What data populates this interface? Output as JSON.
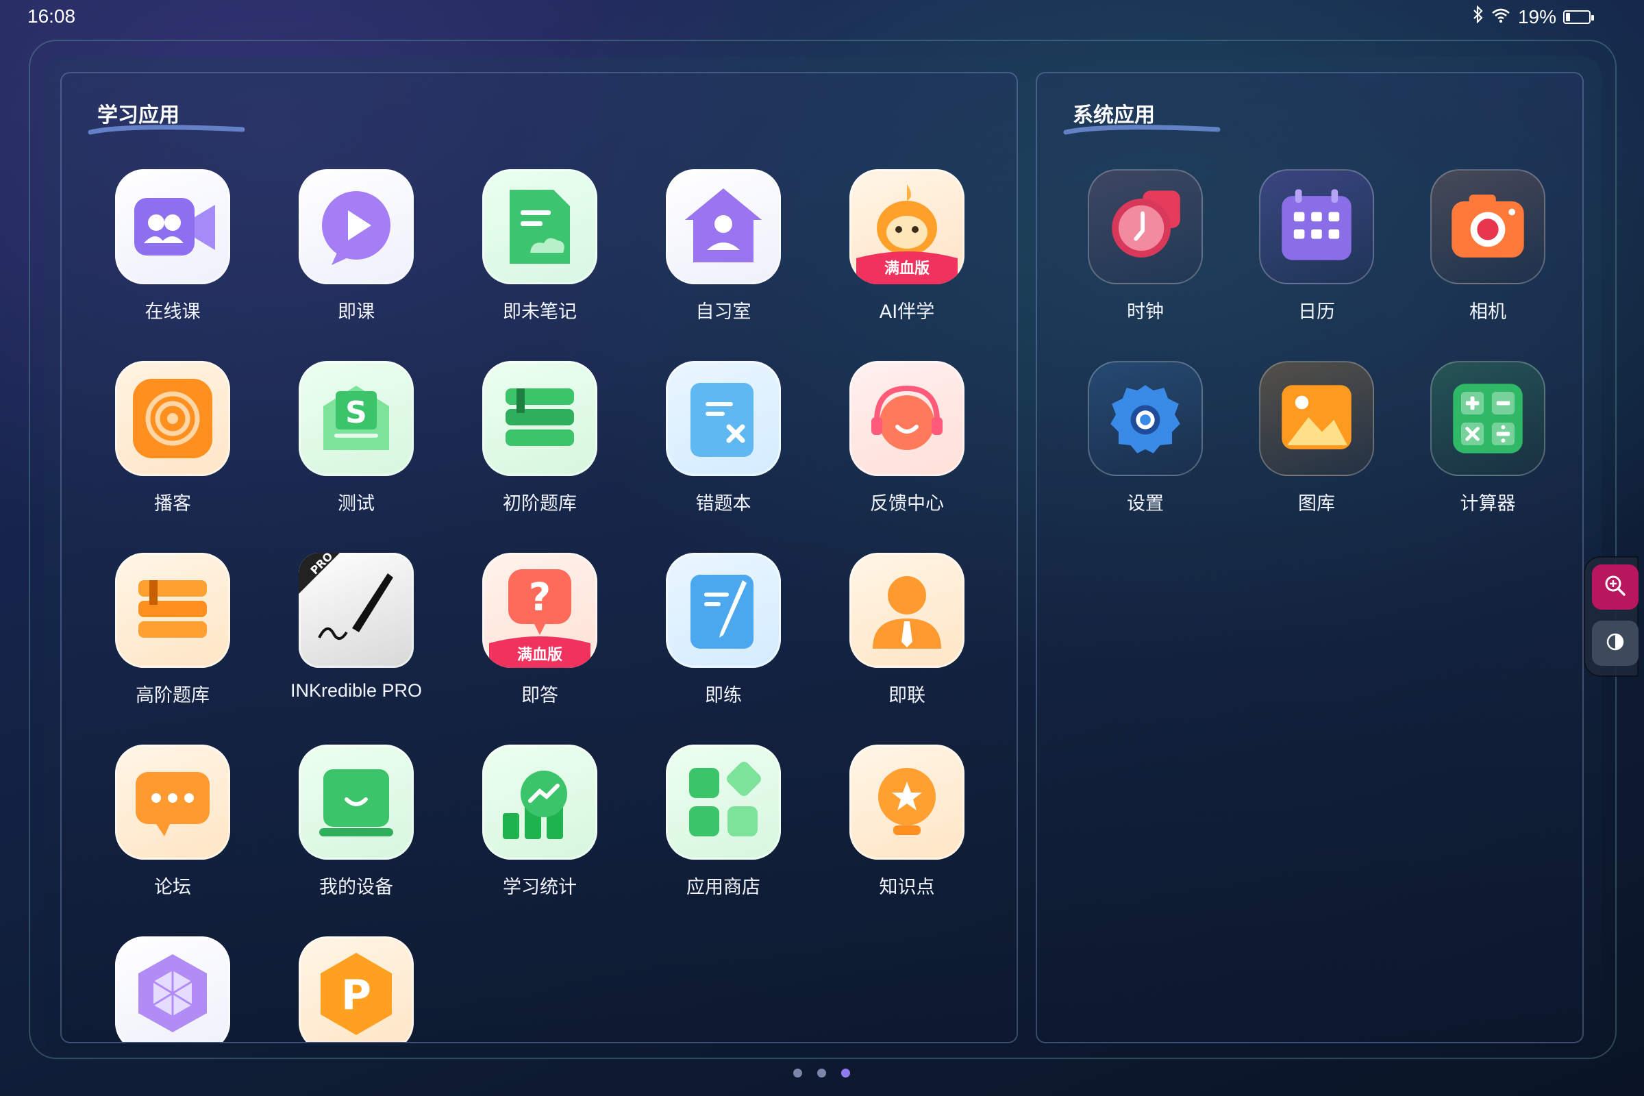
{
  "status_bar": {
    "time": "16:08",
    "battery_percent": "19%",
    "battery_level": 0.19
  },
  "learning_apps": {
    "title": "学习应用",
    "items": [
      {
        "label": "在线课",
        "icon": "video-class-icon"
      },
      {
        "label": "即课",
        "icon": "play-bubble-icon"
      },
      {
        "label": "即未笔记",
        "icon": "notes-icon"
      },
      {
        "label": "自习室",
        "icon": "study-room-icon"
      },
      {
        "label": "AI伴学",
        "icon": "ai-mascot-icon",
        "badge": "满血版"
      },
      {
        "label": "播客",
        "icon": "podcast-icon"
      },
      {
        "label": "测试",
        "icon": "test-icon"
      },
      {
        "label": "初阶题库",
        "icon": "books-green-icon"
      },
      {
        "label": "错题本",
        "icon": "mistake-notebook-icon"
      },
      {
        "label": "反馈中心",
        "icon": "headset-icon"
      },
      {
        "label": "高阶题库",
        "icon": "books-orange-icon"
      },
      {
        "label": "INKredible PRO",
        "icon": "pen-icon",
        "badge": "PRO"
      },
      {
        "label": "即答",
        "icon": "question-icon",
        "badge": "满血版"
      },
      {
        "label": "即练",
        "icon": "practice-icon"
      },
      {
        "label": "即联",
        "icon": "tutor-icon"
      },
      {
        "label": "论坛",
        "icon": "forum-icon"
      },
      {
        "label": "我的设备",
        "icon": "device-icon"
      },
      {
        "label": "学习统计",
        "icon": "stats-icon"
      },
      {
        "label": "应用商店",
        "icon": "app-store-icon"
      },
      {
        "label": "知识点",
        "icon": "knowledge-icon"
      },
      {
        "label": "",
        "icon": "hexagon-cube-icon"
      },
      {
        "label": "",
        "icon": "p-app-icon",
        "glyph": "P"
      }
    ]
  },
  "system_apps": {
    "title": "系统应用",
    "items": [
      {
        "label": "时钟",
        "icon": "clock-icon"
      },
      {
        "label": "日历",
        "icon": "calendar-icon"
      },
      {
        "label": "相机",
        "icon": "camera-icon"
      },
      {
        "label": "设置",
        "icon": "settings-gear-icon"
      },
      {
        "label": "图库",
        "icon": "gallery-icon"
      },
      {
        "label": "计算器",
        "icon": "calculator-icon"
      }
    ]
  },
  "pagination": {
    "pages": 3,
    "current": 3
  },
  "side_tools": [
    {
      "icon": "zoom-in-icon",
      "color": "#b8165e"
    },
    {
      "icon": "contrast-icon",
      "color": "#3d4a5c"
    }
  ]
}
